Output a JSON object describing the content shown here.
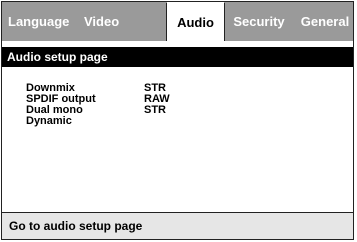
{
  "tabs": {
    "language": "Language",
    "video": "Video",
    "audio": "Audio",
    "security": "Security",
    "general": "General",
    "active": "Audio"
  },
  "page_title": "Audio setup page",
  "settings": [
    {
      "label": "Downmix",
      "value": "STR"
    },
    {
      "label": "SPDIF output",
      "value": "RAW"
    },
    {
      "label": "Dual mono",
      "value": "STR"
    },
    {
      "label": "Dynamic",
      "value": ""
    }
  ],
  "status_text": "Go to audio setup page",
  "colors": {
    "tabbar_bg": "#9a9a9a",
    "title_bg": "#000000",
    "status_bg": "#e6e6e6"
  }
}
